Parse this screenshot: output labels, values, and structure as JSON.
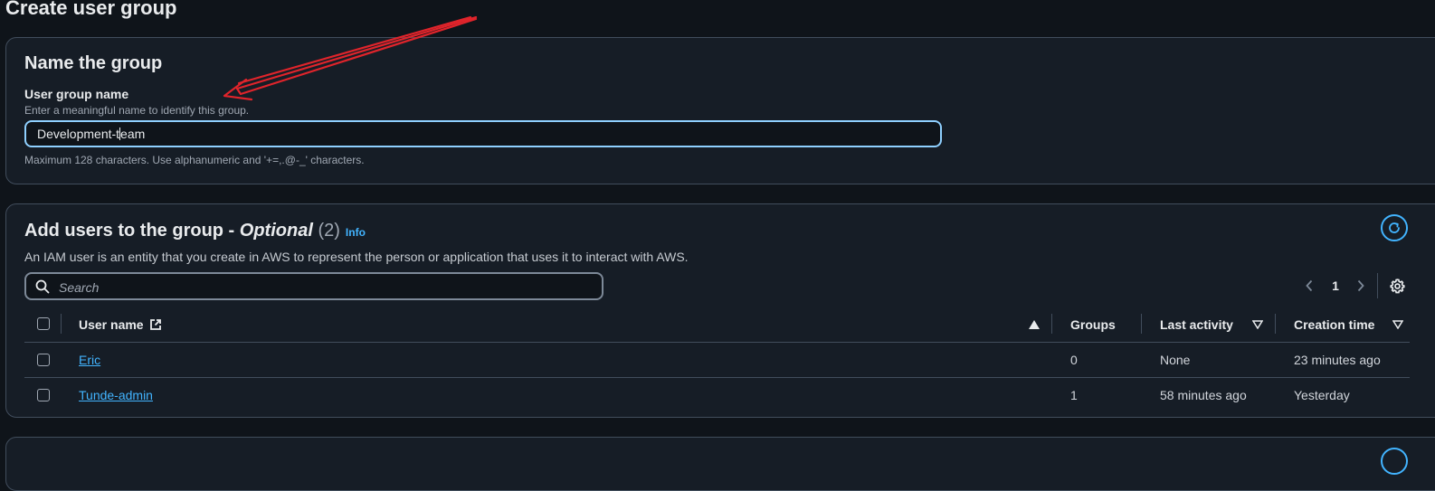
{
  "page": {
    "title": "Create user group"
  },
  "name_section": {
    "title": "Name the group",
    "field_label": "User group name",
    "field_description": "Enter a meaningful name to identify this group.",
    "value_before_caret": "Development-t",
    "value_after_caret": "eam",
    "constraint": "Maximum 128 characters. Use alphanumeric and '+=,.@-_' characters."
  },
  "users_section": {
    "title_main": "Add users to the group - ",
    "title_optional": "Optional",
    "count": "(2)",
    "info": "Info",
    "description": "An IAM user is an entity that you create in AWS to represent the person or application that uses it to interact with AWS.",
    "search_placeholder": "Search",
    "page": "1",
    "columns": {
      "user_name": "User name",
      "groups": "Groups",
      "last_activity": "Last activity",
      "creation_time": "Creation time"
    },
    "rows": [
      {
        "user_name": "Eric",
        "groups": "0",
        "last_activity": "None",
        "creation_time": "23 minutes ago"
      },
      {
        "user_name": "Tunde-admin",
        "groups": "1",
        "last_activity": "58 minutes ago",
        "creation_time": "Yesterday"
      }
    ]
  },
  "icons": {
    "refresh": "refresh-icon",
    "search": "search-icon",
    "external": "external-link-icon",
    "settings": "gear-icon"
  },
  "colors": {
    "accent": "#42b4ff",
    "annotation_arrow": "#e0242b",
    "focus_border": "#8fd0ff"
  }
}
